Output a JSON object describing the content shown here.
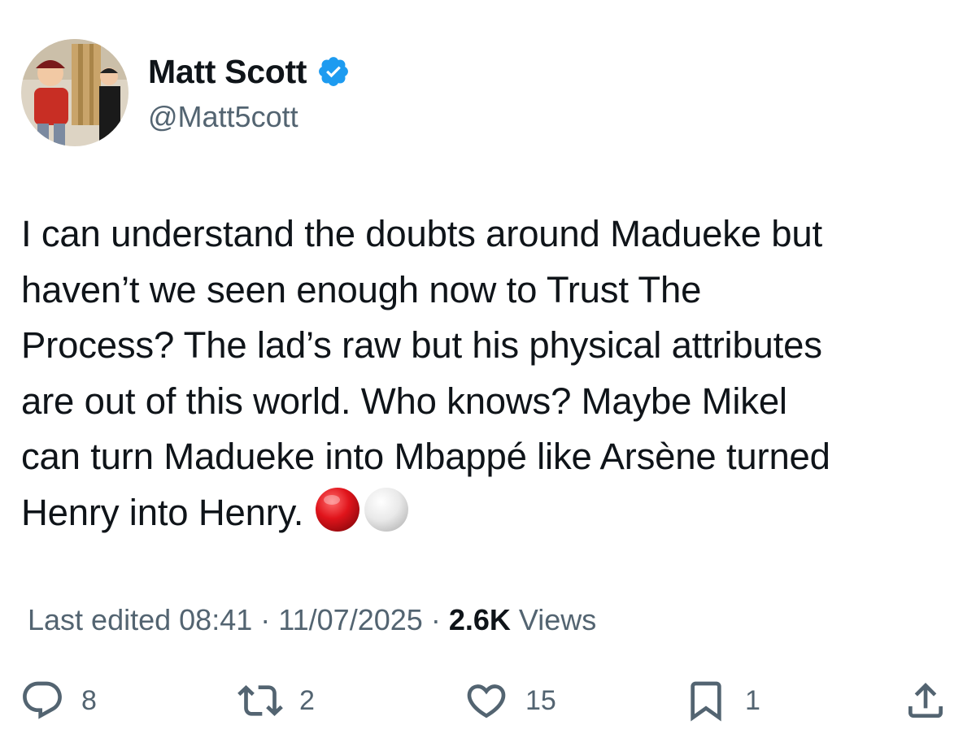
{
  "author": {
    "name": "Matt Scott",
    "handle": "@Matt5cott",
    "verified": true,
    "verified_color": "#1d9bf0"
  },
  "tweet": {
    "lines": [
      "I can understand the doubts around Madueke but",
      "haven’t we seen enough now to Trust The",
      "Process? The lad’s raw but his physical attributes",
      "are out of this world. Who knows? Maybe Mikel",
      "can turn Madueke into Mbappé like Arsène turned",
      "Henry into Henry."
    ],
    "emojis": [
      "red-circle",
      "white-circle"
    ]
  },
  "meta": {
    "edited_prefix": "Last edited",
    "time": "08:41",
    "date": "11/07/2025",
    "separator": "·",
    "views_count": "2.6K",
    "views_label": "Views"
  },
  "actions": {
    "replies": "8",
    "reposts": "2",
    "likes": "15",
    "bookmarks": "1"
  },
  "colors": {
    "text": "#0f1419",
    "secondary": "#536471",
    "accent": "#1d9bf0"
  }
}
